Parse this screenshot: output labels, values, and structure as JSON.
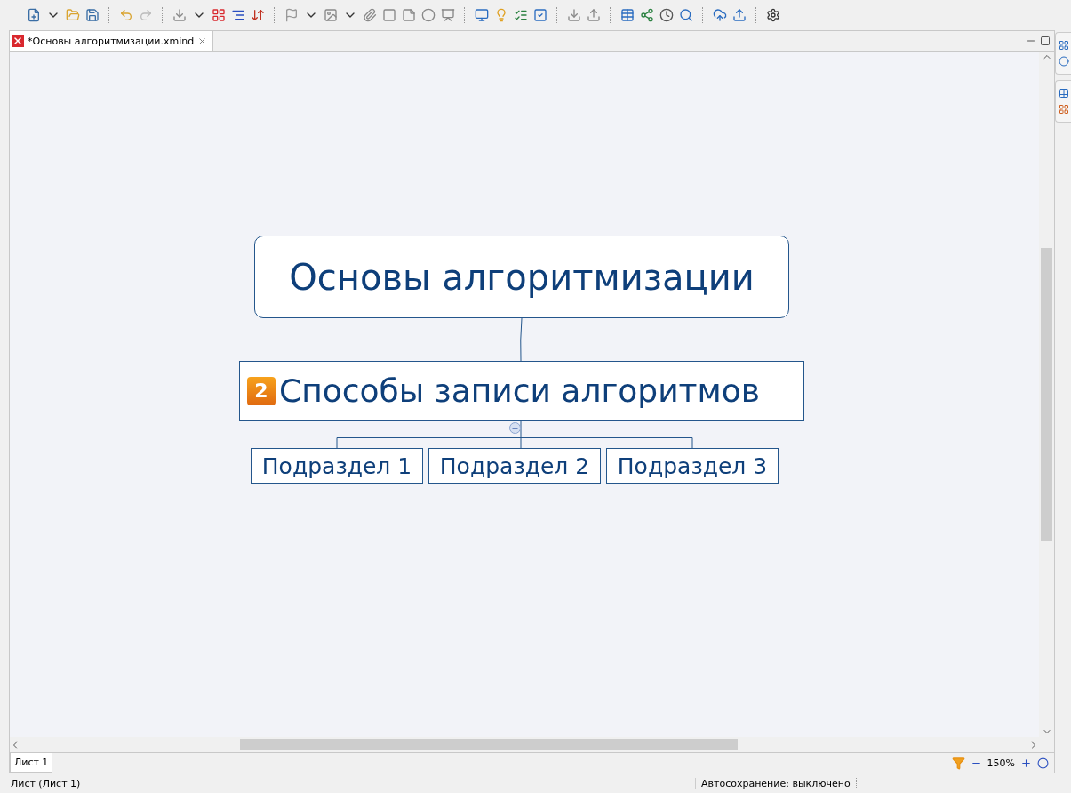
{
  "editor_tab": {
    "title": "*Основы алгоритмизации.xmind",
    "selected": true
  },
  "map": {
    "central": {
      "title": "Основы алгоритмизации"
    },
    "main_topic": {
      "title": "Способы записи алгоритмов",
      "marker": "2",
      "expanded": true,
      "children": [
        {
          "title": "Подраздел 1"
        },
        {
          "title": "Подраздел 2"
        },
        {
          "title": "Подраздел 3"
        }
      ]
    }
  },
  "sheet_tabs": [
    {
      "label": "Лист 1",
      "selected": true
    }
  ],
  "zoom": {
    "value": "150%"
  },
  "status_bar": {
    "left": "Лист (Лист 1)",
    "autosave": "Автосохранение: выключено"
  }
}
